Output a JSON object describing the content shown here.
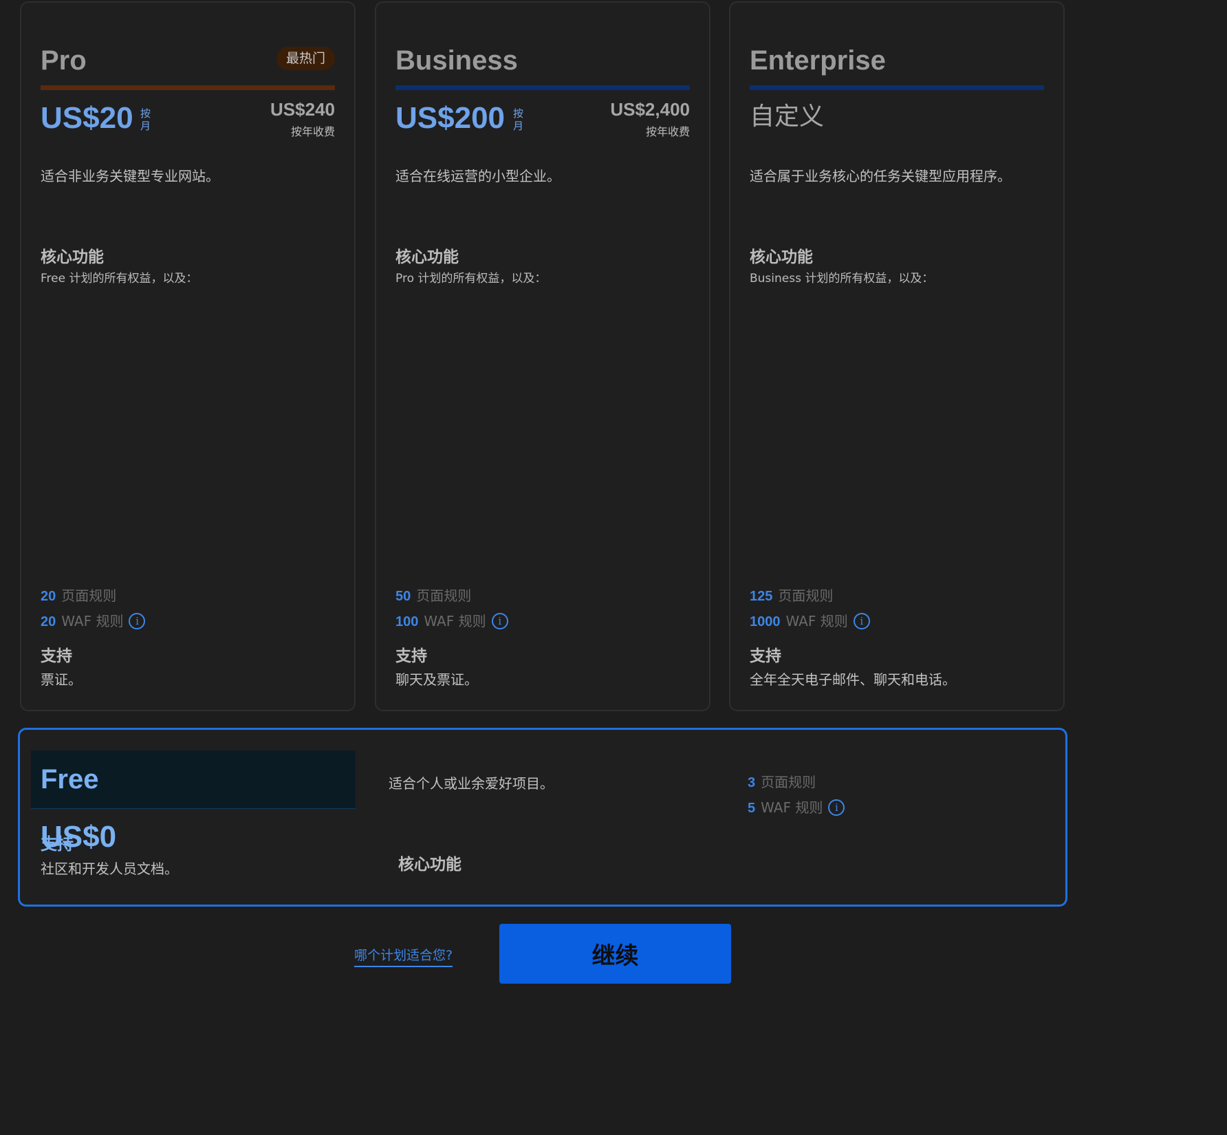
{
  "colors": {
    "background": "#1d1d1e",
    "pro_accent": "#5a2a0c",
    "plan_accent": "#0a2f6e",
    "price_blue": "#6fa3ea",
    "link_blue": "#3d86e6",
    "selected_border": "#1f70e0",
    "button_blue": "#0a5ee0"
  },
  "plans": [
    {
      "name": "Pro",
      "badge": "最热门",
      "price": "US$20",
      "per": "按月",
      "annual_price": "US$240",
      "annual_note": "按年收费",
      "description": "适合非业务关键型专业网站。",
      "core_title": "核心功能",
      "core_sub": "Free 计划的所有权益，以及：",
      "page_rules_num": "20",
      "page_rules_label": "页面规则",
      "waf_rules_num": "20",
      "waf_rules_label": "WAF 规则",
      "support_title": "支持",
      "support_text": "票证。"
    },
    {
      "name": "Business",
      "price": "US$200",
      "per": "按月",
      "annual_price": "US$2,400",
      "annual_note": "按年收费",
      "description": "适合在线运营的小型企业。",
      "core_title": "核心功能",
      "core_sub": "Pro 计划的所有权益，以及：",
      "page_rules_num": "50",
      "page_rules_label": "页面规则",
      "waf_rules_num": "100",
      "waf_rules_label": "WAF 规则",
      "support_title": "支持",
      "support_text": "聊天及票证。"
    },
    {
      "name": "Enterprise",
      "price": "自定义",
      "description": "适合属于业务核心的任务关键型应用程序。",
      "core_title": "核心功能",
      "core_sub": "Business 计划的所有权益，以及：",
      "page_rules_num": "125",
      "page_rules_label": "页面规则",
      "waf_rules_num": "1000",
      "waf_rules_label": "WAF 规则",
      "support_title": "支持",
      "support_text": "全年全天电子邮件、聊天和电话。"
    }
  ],
  "free": {
    "name": "Free",
    "price": "US$0",
    "support_title": "支持",
    "support_text": "社区和开发人员文档。",
    "description": "适合个人或业余爱好项目。",
    "core_title": "核心功能",
    "page_rules_num": "3",
    "page_rules_label": "页面规则",
    "waf_rules_num": "5",
    "waf_rules_label": "WAF 规则"
  },
  "footer": {
    "help_link": "哪个计划适合您?",
    "continue_label": "继续"
  },
  "icons": {
    "info": "i"
  }
}
